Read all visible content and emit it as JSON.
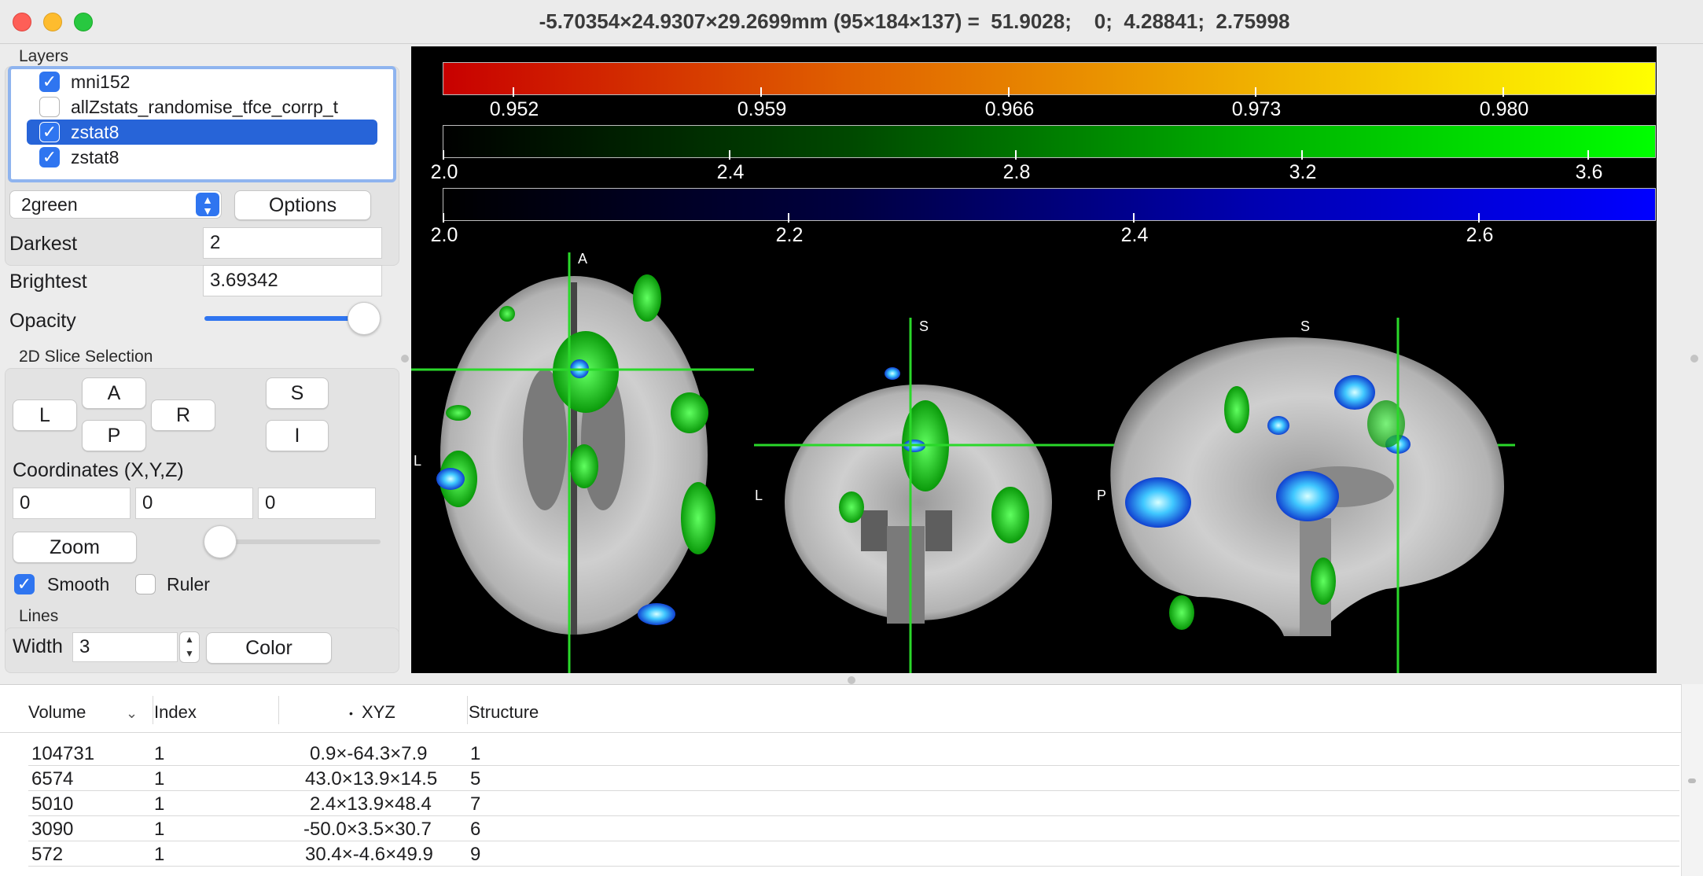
{
  "window": {
    "title": "-5.70354×24.9307×29.2699mm (95×184×137) =  51.9028;    0;  4.28841;  2.75998"
  },
  "layers": {
    "group_title": "Layers",
    "items": [
      {
        "name": "mni152",
        "checked": true,
        "selected": false
      },
      {
        "name": "allZstats_randomise_tfce_corrp_t",
        "checked": false,
        "selected": false
      },
      {
        "name": "zstat8",
        "checked": true,
        "selected": true
      },
      {
        "name": "zstat8",
        "checked": true,
        "selected": false
      }
    ],
    "colormap": "2green",
    "options_label": "Options",
    "darkest_label": "Darkest",
    "darkest_value": "2",
    "brightest_label": "Brightest",
    "brightest_value": "3.69342",
    "opacity_label": "Opacity",
    "opacity_level": 0.97
  },
  "slice_selection": {
    "group_title": "2D Slice Selection",
    "buttons": {
      "l": "L",
      "a": "A",
      "p": "P",
      "r": "R",
      "s": "S",
      "i": "I"
    },
    "coordinates_label": "Coordinates (X,Y,Z)",
    "x": "0",
    "y": "0",
    "z": "0",
    "zoom_label": "Zoom",
    "zoom_level": 0.0,
    "smooth_label": "Smooth",
    "smooth_checked": true,
    "ruler_label": "Ruler",
    "ruler_checked": false
  },
  "lines": {
    "group_title": "Lines",
    "width_label": "Width",
    "width_value": "3",
    "color_label": "Color",
    "line_color": "#2ad82a"
  },
  "colorbars": [
    {
      "name": "red-yellow",
      "ticks": [
        "0.952",
        "0.959",
        "0.966",
        "0.973",
        "0.980"
      ]
    },
    {
      "name": "green",
      "ticks": [
        "2.0",
        "2.4",
        "2.8",
        "3.2",
        "3.6"
      ]
    },
    {
      "name": "blue",
      "ticks": [
        "2.0",
        "2.2",
        "2.4",
        "2.6"
      ]
    }
  ],
  "orientation": {
    "axial_top": "A",
    "axial_left": "L",
    "coronal_top": "S",
    "coronal_left": "L",
    "sagittal_top": "S",
    "sagittal_left": "P"
  },
  "table": {
    "headers": {
      "volume": "Volume",
      "index": "Index",
      "xyz": "XYZ",
      "structure": "Structure"
    },
    "rows": [
      {
        "volume": "104731",
        "index": "1",
        "xyz": "0.9×-64.3×7.9",
        "structure": "1"
      },
      {
        "volume": "6574",
        "index": "1",
        "xyz": "43.0×13.9×14.5",
        "structure": "5"
      },
      {
        "volume": "5010",
        "index": "1",
        "xyz": "2.4×13.9×48.4",
        "structure": "7"
      },
      {
        "volume": "3090",
        "index": "1",
        "xyz": "-50.0×3.5×30.7",
        "structure": "6"
      },
      {
        "volume": "572",
        "index": "1",
        "xyz": "30.4×-4.6×49.9",
        "structure": "9"
      }
    ]
  }
}
